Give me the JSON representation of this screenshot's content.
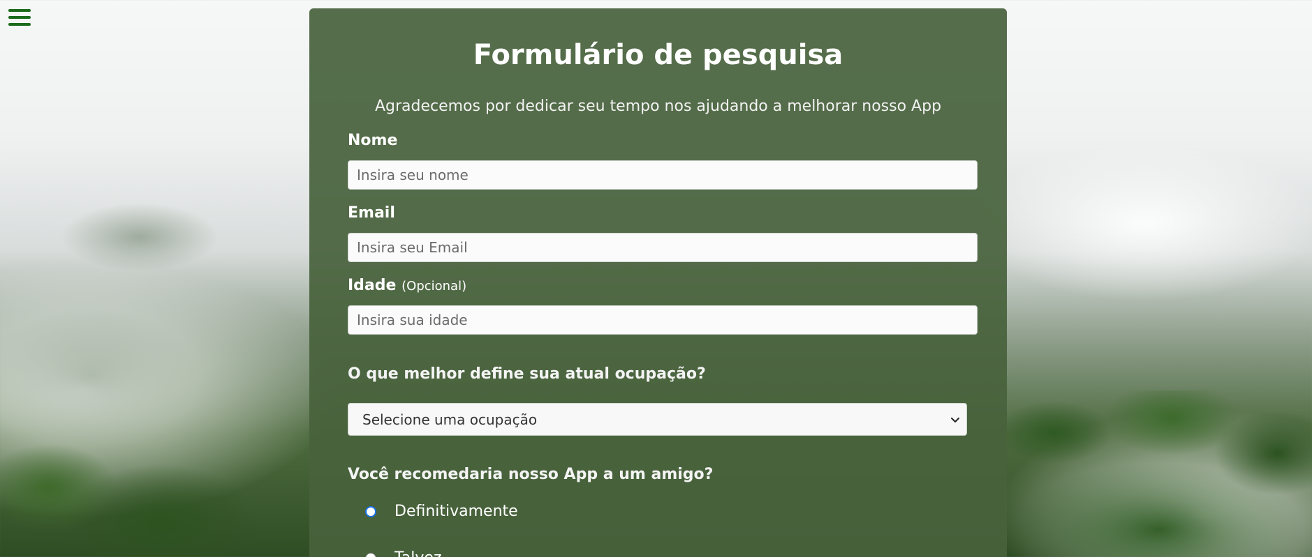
{
  "nav": {
    "menu_icon": "hamburger-menu-icon"
  },
  "form": {
    "title": "Formulário de pesquisa",
    "subtitle": "Agradecemos por dedicar seu tempo nos ajudando a melhorar nosso App",
    "name": {
      "label": "Nome",
      "placeholder": "Insira seu nome",
      "value": ""
    },
    "email": {
      "label": "Email",
      "placeholder": "Insira seu Email",
      "value": ""
    },
    "age": {
      "label": "Idade",
      "optional_label": "(Opcional)",
      "placeholder": "Insira sua idade",
      "value": ""
    },
    "occupation": {
      "question": "O que melhor define sua atual ocupação?",
      "selected": "Selecione uma ocupação"
    },
    "recommend": {
      "question": "Você recomedaria nosso App a um amigo?",
      "options": [
        {
          "label": "Definitivamente",
          "checked": true
        },
        {
          "label": "Talvez",
          "checked": false
        }
      ]
    }
  },
  "colors": {
    "card_background": "#48623c",
    "menu_icon": "#1b6b1b",
    "radio_accent": "#1a73e8"
  }
}
